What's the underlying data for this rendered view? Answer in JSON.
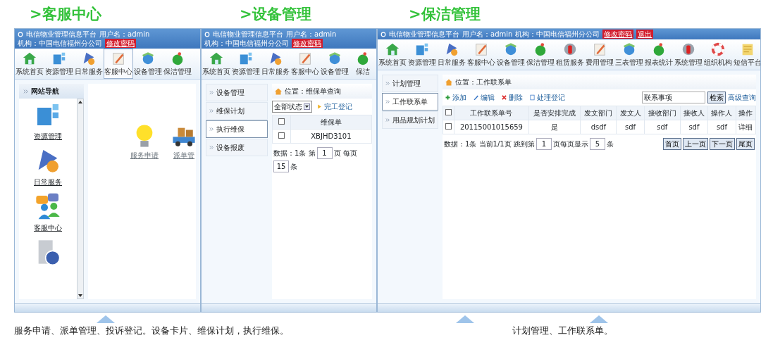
{
  "headings": [
    {
      "text": ">客服中心"
    },
    {
      "text": ">设备管理"
    },
    {
      "text": ">保洁管理"
    }
  ],
  "panels": [
    {
      "kind": "portal",
      "title_bar": {
        "parts": [
          "电信物业管理信息平台",
          "用户名：admin",
          "机构：中国电信福州分公司"
        ],
        "links": [
          "修改密码"
        ]
      },
      "toolbar": [
        {
          "label": "系统首页",
          "selected": false
        },
        {
          "label": "资源管理",
          "selected": false
        },
        {
          "label": "日常服务",
          "selected": false
        },
        {
          "label": "客服中心",
          "selected": true
        },
        {
          "label": "设备管理",
          "selected": false
        },
        {
          "label": "保洁管理",
          "selected": false
        }
      ],
      "sidebar": {
        "title": "网站导航",
        "items": [
          {
            "kind": "labeled",
            "label": "资源管理"
          },
          {
            "kind": "labeled",
            "label": "日常服务"
          },
          {
            "kind": "labeled",
            "label": "客服中心"
          },
          {
            "kind": "icon"
          }
        ]
      },
      "main": {
        "shortcuts": [
          {
            "label": "服务申请"
          },
          {
            "label": "派单管"
          }
        ]
      }
    },
    {
      "kind": "query",
      "title_bar": {
        "parts": [
          "电信物业管理信息平台",
          "用户名：admin",
          "机构：中国电信福州分公司"
        ],
        "links": [
          "修改密码"
        ]
      },
      "toolbar": [
        {
          "label": "系统首页",
          "selected": false
        },
        {
          "label": "资源管理",
          "selected": false
        },
        {
          "label": "日常服务",
          "selected": false
        },
        {
          "label": "客服中心",
          "selected": false
        },
        {
          "label": "设备管理",
          "selected": false
        },
        {
          "label": "保洁",
          "selected": false
        }
      ],
      "sidebar": {
        "items": [
          {
            "label": "设备管理",
            "selected": false
          },
          {
            "label": "维保计划",
            "selected": false
          },
          {
            "label": "执行维保",
            "selected": true
          },
          {
            "label": "设备报废",
            "selected": false
          }
        ]
      },
      "main": {
        "location": "位置：维保单查询",
        "filter": "全部状态",
        "actions": [
          {
            "label": "完工登记"
          }
        ],
        "table": {
          "header_checked": false,
          "columns": [
            "维保单"
          ],
          "rows": [
            {
              "checked": false,
              "cells": [
                "XBJHD3101"
              ]
            }
          ]
        },
        "pager": [
          {
            "kind": "text",
            "text": "数据：1条 第"
          },
          {
            "kind": "input",
            "value": "1"
          },
          {
            "kind": "text",
            "text": "页 每页"
          },
          {
            "kind": "input",
            "value": "15"
          },
          {
            "kind": "text",
            "text": "条"
          }
        ]
      }
    },
    {
      "kind": "list",
      "title_bar": {
        "parts": [
          "电信物业管理信息平台",
          "用户名：admin",
          "机构：中国电信福州分公司"
        ],
        "links": [
          "修改密码",
          "退出"
        ]
      },
      "toolbar": [
        {
          "label": "系统首页",
          "selected": false
        },
        {
          "label": "资源管理",
          "selected": false
        },
        {
          "label": "日常服务",
          "selected": false
        },
        {
          "label": "客服中心",
          "selected": false
        },
        {
          "label": "设备管理",
          "selected": false
        },
        {
          "label": "保洁管理",
          "selected": false
        },
        {
          "label": "租赁服务",
          "selected": false
        },
        {
          "label": "费用管理",
          "selected": false
        },
        {
          "label": "三表管理",
          "selected": false
        },
        {
          "label": "报表统计",
          "selected": false
        },
        {
          "label": "系统管理",
          "selected": false
        },
        {
          "label": "组织机构",
          "selected": false
        },
        {
          "label": "短信平台",
          "selected": false
        }
      ],
      "sidebar": {
        "items": [
          {
            "label": "计划管理",
            "selected": false
          },
          {
            "label": "工作联系单",
            "selected": true
          },
          {
            "label": "用品规划计划",
            "selected": false
          }
        ]
      },
      "main": {
        "location": "位置：工作联系单",
        "actions": [
          {
            "label": "添加"
          },
          {
            "label": "编辑"
          },
          {
            "label": "删除"
          },
          {
            "label": "处理登记"
          }
        ],
        "search": {
          "value": "联系事项",
          "button": "检索",
          "link": "高级查询"
        },
        "table": {
          "header_checked": false,
          "columns": [
            "工作联系单号",
            "是否安排完成",
            "发文部门",
            "发文人",
            "接收部门",
            "接收人",
            "操作人",
            "操作"
          ],
          "rows": [
            {
              "checked": false,
              "cells": [
                "20115001015659",
                "是",
                "dsdf",
                "sdf",
                "sdf",
                "sdf",
                "sdf",
                "详细"
              ]
            }
          ]
        },
        "pager": [
          {
            "kind": "text",
            "text": "数据：1条 当前1/1页 跳到第"
          },
          {
            "kind": "input",
            "value": "1"
          },
          {
            "kind": "text",
            "text": "页每页显示"
          },
          {
            "kind": "input",
            "value": "5"
          },
          {
            "kind": "text",
            "text": "条"
          }
        ],
        "pager_buttons": [
          "首页",
          "上一页",
          "下一页",
          "尾页"
        ]
      }
    }
  ],
  "captions": [
    {
      "text": "服务申请、派单管理、投诉登记。设备卡片、维保计划，执行维保。"
    },
    {
      "text": "计划管理、工作联系单。"
    }
  ]
}
